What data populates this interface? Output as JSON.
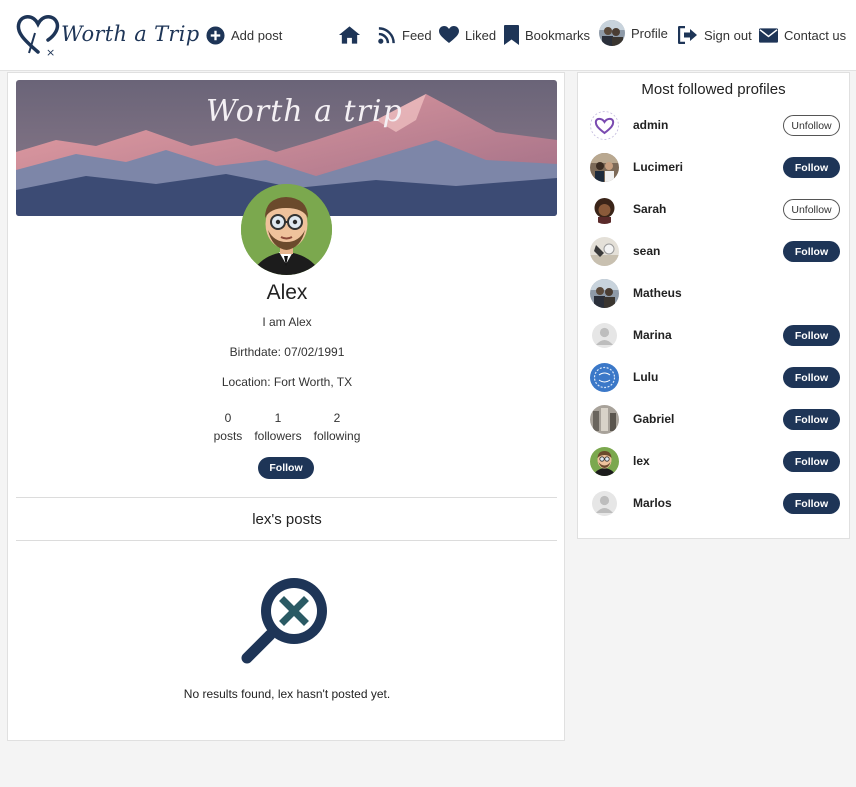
{
  "nav": {
    "logo_text": "Worth a Trip",
    "add_post": "Add post",
    "feed": "Feed",
    "liked": "Liked",
    "bookmarks": "Bookmarks",
    "profile": "Profile",
    "sign_out": "Sign out",
    "contact": "Contact us"
  },
  "profile": {
    "banner_text": "Worth a trip",
    "name": "Alex",
    "bio": "I am Alex",
    "birthdate": "Birthdate: 07/02/1991",
    "location": "Location: Fort Worth, TX",
    "stats": [
      {
        "value": "0",
        "label": "posts"
      },
      {
        "value": "1",
        "label": "followers"
      },
      {
        "value": "2",
        "label": "following"
      }
    ],
    "follow_label": "Follow"
  },
  "posts": {
    "title": "lex's posts",
    "empty_message": "No results found, lex hasn't posted yet."
  },
  "sidebar": {
    "title": "Most followed profiles",
    "profiles": [
      {
        "name": "admin",
        "action": "Unfollow"
      },
      {
        "name": "Lucimeri",
        "action": "Follow"
      },
      {
        "name": "Sarah",
        "action": "Unfollow"
      },
      {
        "name": "sean",
        "action": "Follow"
      },
      {
        "name": "Matheus",
        "action": ""
      },
      {
        "name": "Marina",
        "action": "Follow"
      },
      {
        "name": "Lulu",
        "action": "Follow"
      },
      {
        "name": "Gabriel",
        "action": "Follow"
      },
      {
        "name": "lex",
        "action": "Follow"
      },
      {
        "name": "Marlos",
        "action": "Follow"
      }
    ]
  },
  "colors": {
    "brand": "#1e3557",
    "background": "#f4f4f4",
    "border": "#e0e0e0"
  }
}
